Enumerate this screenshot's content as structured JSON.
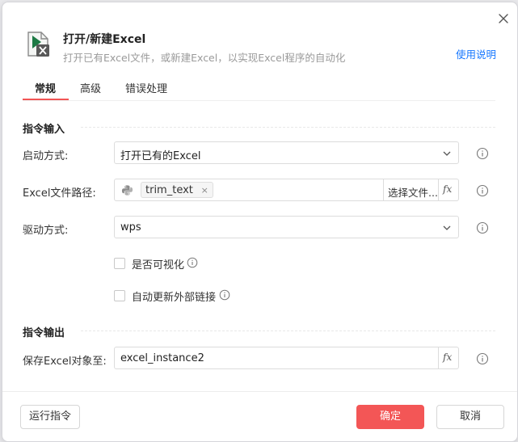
{
  "header": {
    "title": "打开/新建Excel",
    "subtitle": "打开已有Excel文件，或新建Excel，以实现Excel程序的自动化",
    "help_link": "使用说明"
  },
  "tabs": [
    {
      "label": "常规",
      "active": true
    },
    {
      "label": "高级",
      "active": false
    },
    {
      "label": "错误处理",
      "active": false
    }
  ],
  "input_section": {
    "title": "指令输入",
    "launch_mode": {
      "label": "启动方式:",
      "value": "打开已有的Excel"
    },
    "file_path": {
      "label": "Excel文件路径:",
      "tag": "trim_text",
      "tag_close": "×",
      "select_button": "选择文件..."
    },
    "driver": {
      "label": "驱动方式:",
      "value": "wps"
    },
    "visible_checkbox": {
      "label": "是否可视化",
      "checked": false
    },
    "update_links_checkbox": {
      "label": "自动更新外部链接",
      "checked": false
    }
  },
  "output_section": {
    "title": "指令输出",
    "save_to": {
      "label": "保存Excel对象至:",
      "value": "excel_instance2"
    }
  },
  "fx_label": "fx",
  "footer": {
    "run_button": "运行指令",
    "ok_button": "确定",
    "cancel_button": "取消"
  },
  "colors": {
    "accent": "#f35656",
    "link": "#1677ff",
    "excel_green": "#1d7a45"
  },
  "icons": [
    "close-icon",
    "excel-file-icon",
    "chevron-down-icon",
    "info-icon",
    "python-icon",
    "fx-icon"
  ]
}
